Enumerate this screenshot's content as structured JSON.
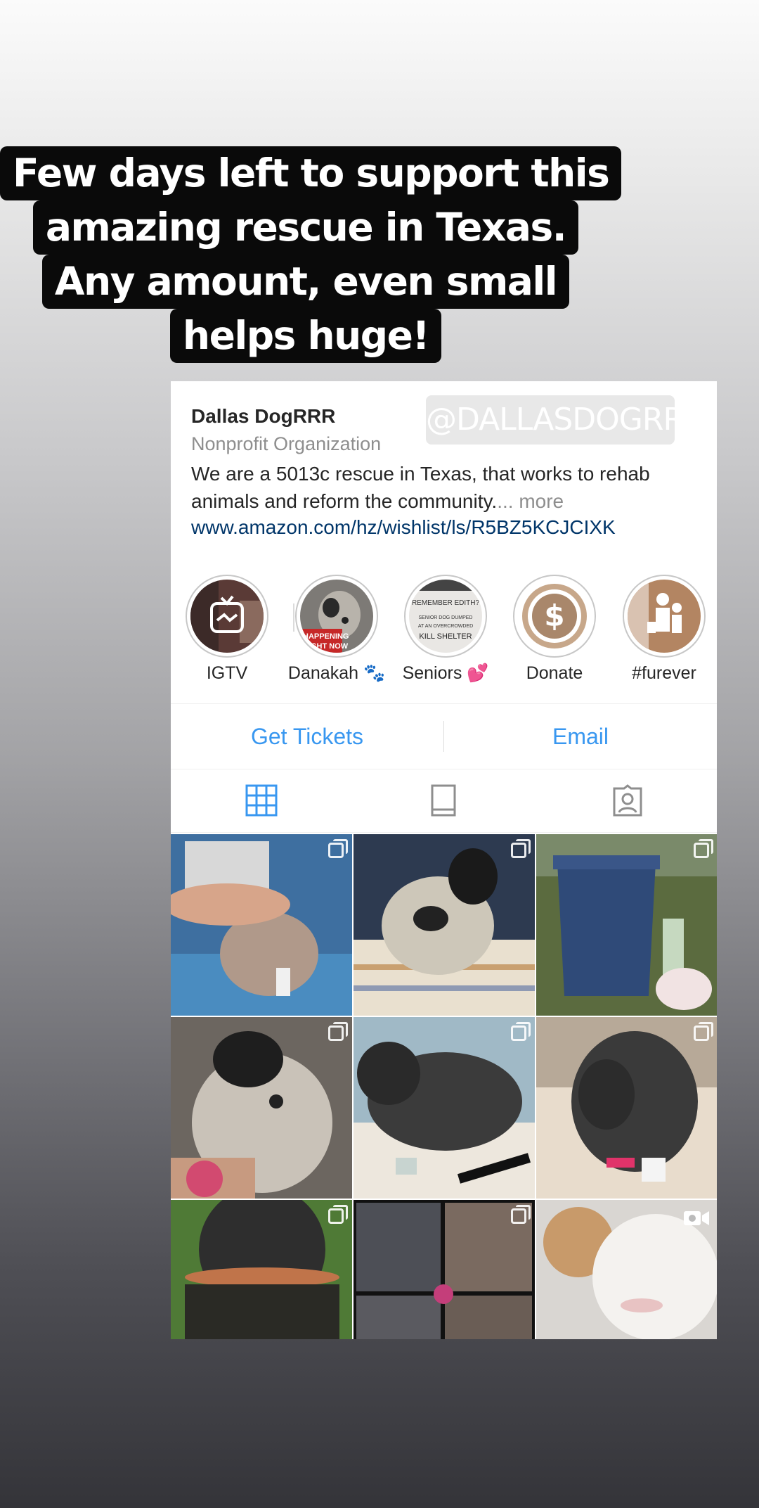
{
  "caption": {
    "lines": [
      "Few days left to support this",
      "amazing rescue in Texas.",
      "Any amount, even small",
      "helps huge!"
    ]
  },
  "watermark": "@DALLASDOGRRR",
  "profile": {
    "name": "Dallas DogRRR",
    "category": "Nonprofit Organization",
    "bio": "We are a 5013c rescue in Texas, that works to rehab animals and reform the community.",
    "bio_more": "... more",
    "link": "www.amazon.com/hz/wishlist/ls/R5BZ5KCJCIXK"
  },
  "highlights": [
    {
      "label": "IGTV",
      "icon": "igtv-icon"
    },
    {
      "label": "Danakah 🐾",
      "icon": "dog-photo"
    },
    {
      "label": "Seniors 💕",
      "icon": "poster"
    },
    {
      "label": "Donate",
      "icon": "dollar-icon"
    },
    {
      "label": "#furever",
      "icon": "family-icon"
    }
  ],
  "highlight_poster": {
    "line1": "REMEMBER EDITH?",
    "line2": "SENIOR DOG DUMPED",
    "line3": "AT AN OVERCROWDED",
    "line4": "KILL SHELTER"
  },
  "highlight_dog_banner": {
    "line1": "HAPPENING",
    "line2": "RIGHT NOW"
  },
  "buttons": {
    "tickets": "Get Tickets",
    "email": "Email"
  },
  "tabs": [
    "grid-icon",
    "feed-icon",
    "tagged-icon"
  ],
  "colors": {
    "link_blue": "#3897f0",
    "bio_link": "#003569"
  }
}
